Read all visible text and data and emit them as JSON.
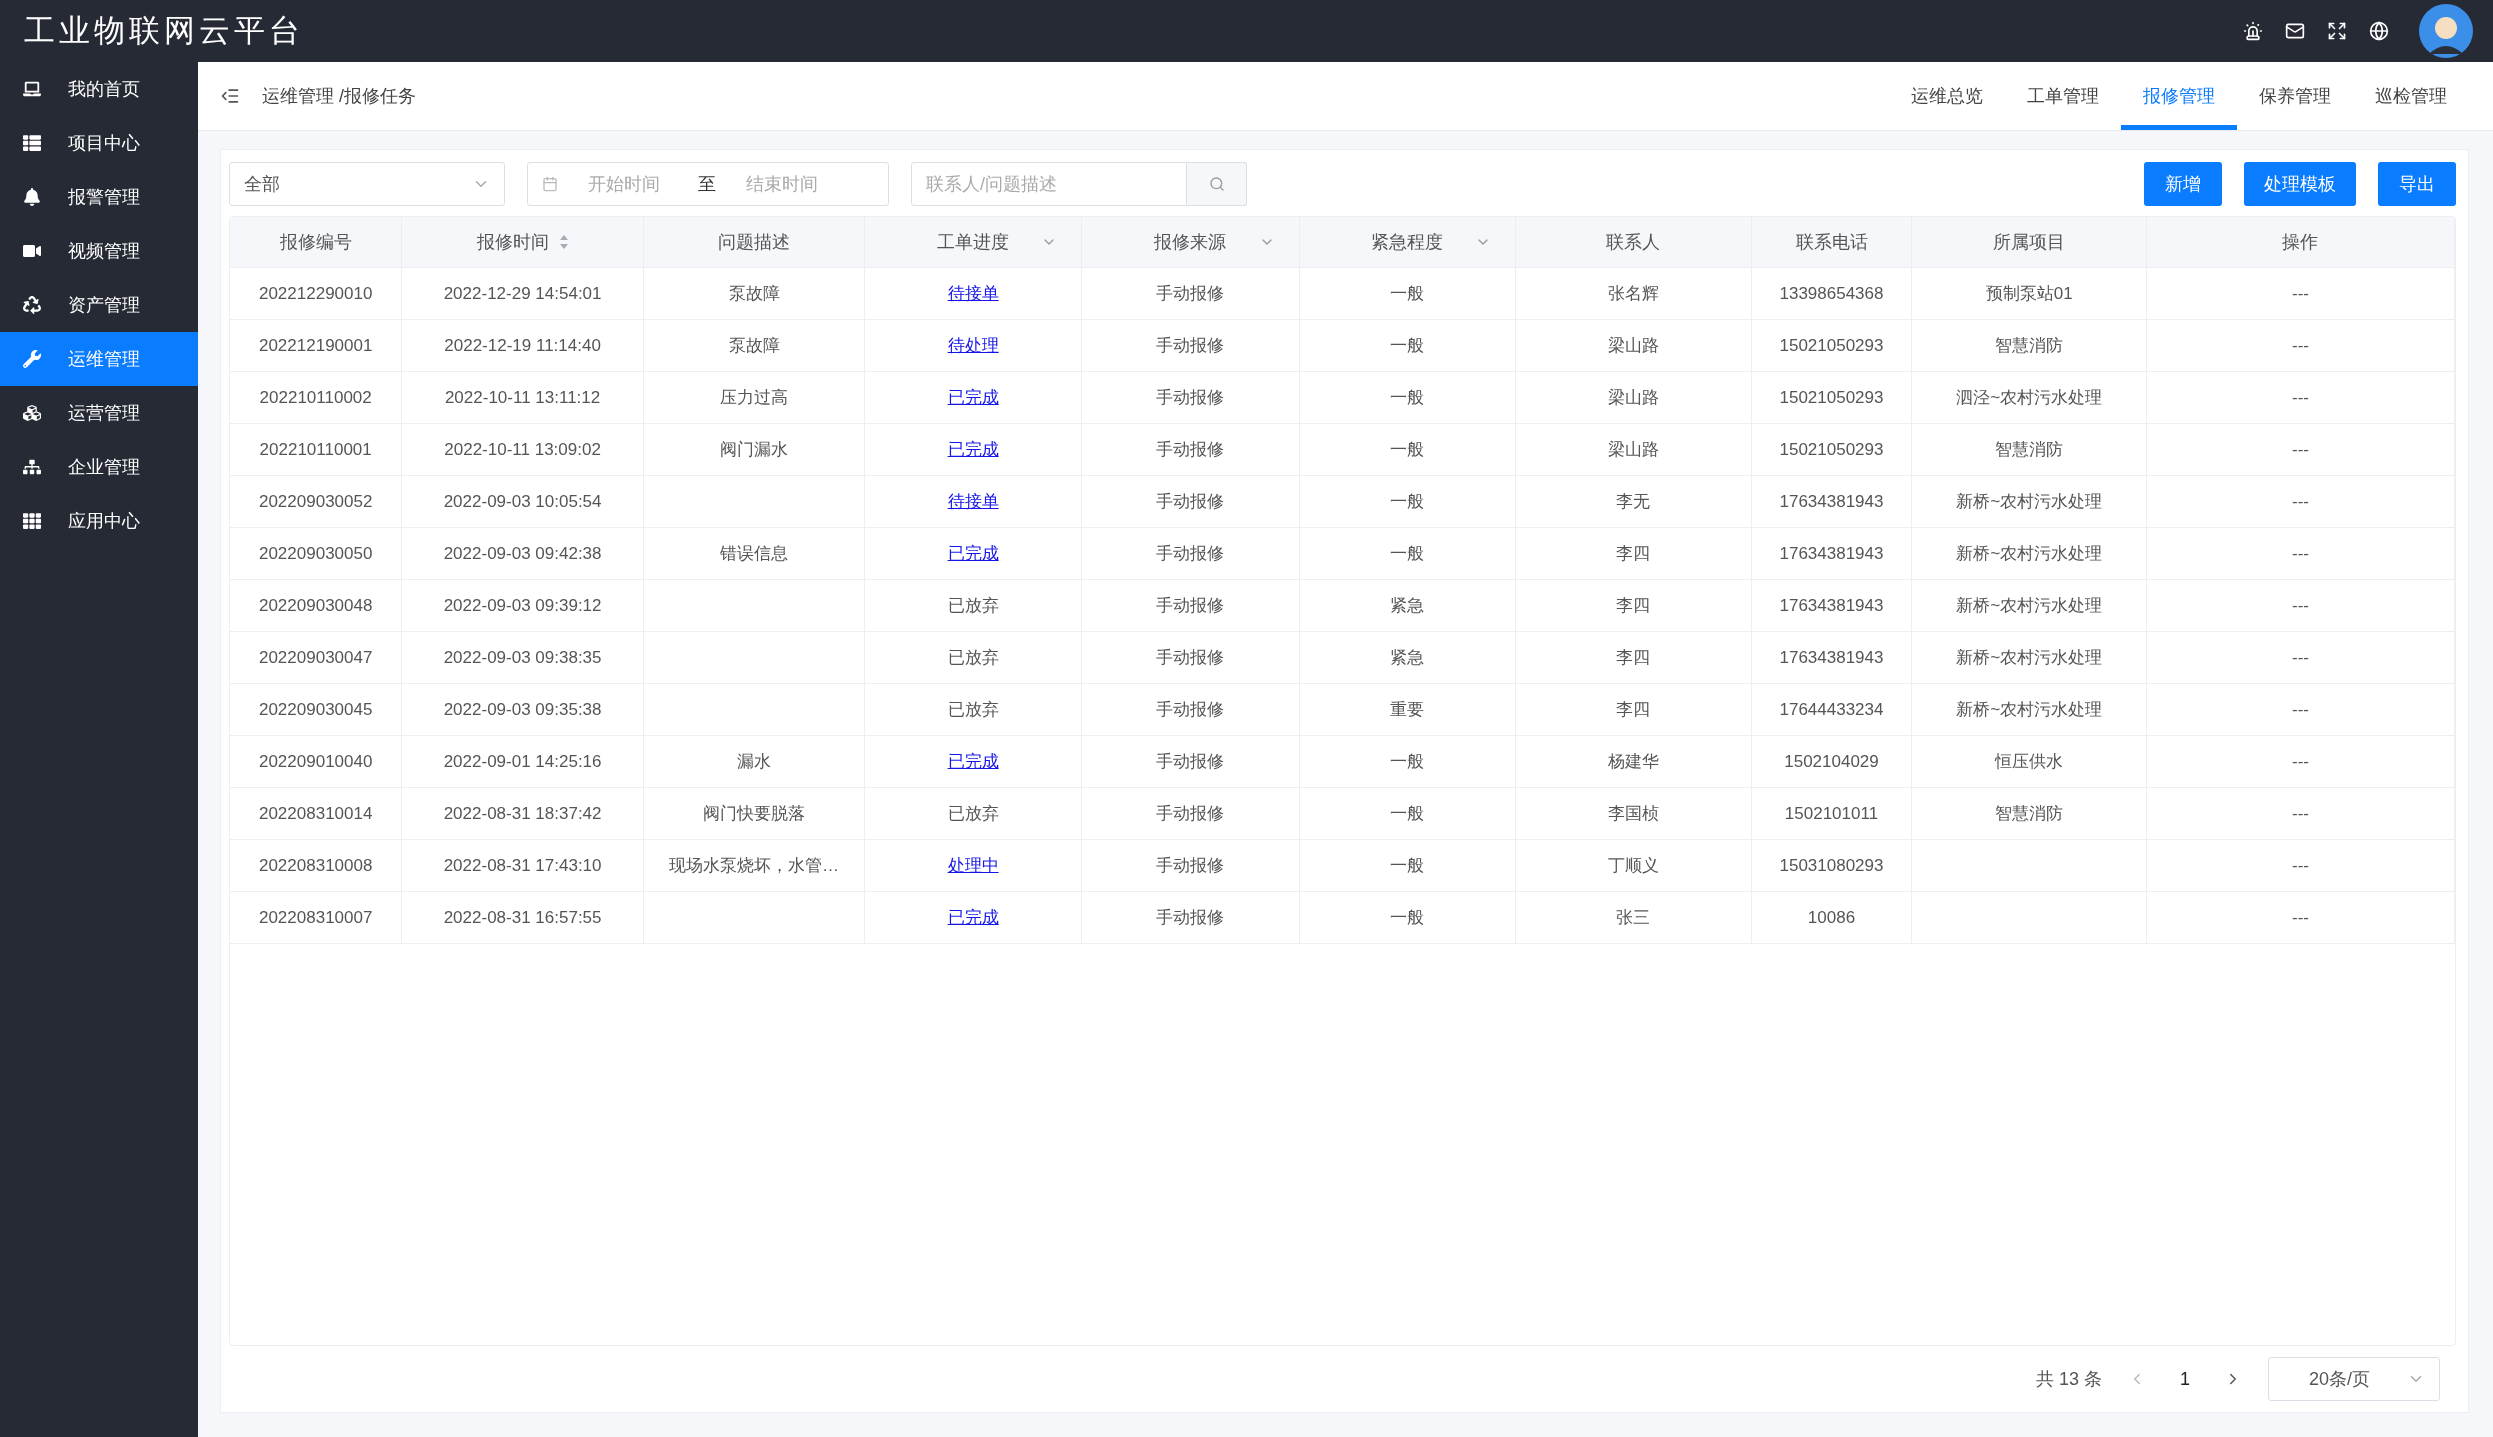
{
  "app_title": "工业物联网云平台",
  "sidebar": {
    "items": [
      {
        "label": "我的首页",
        "selected": false
      },
      {
        "label": "项目中心",
        "selected": false
      },
      {
        "label": "报警管理",
        "selected": false
      },
      {
        "label": "视频管理",
        "selected": false
      },
      {
        "label": "资产管理",
        "selected": false
      },
      {
        "label": "运维管理",
        "selected": true
      },
      {
        "label": "运营管理",
        "selected": false
      },
      {
        "label": "企业管理",
        "selected": false
      },
      {
        "label": "应用中心",
        "selected": false
      }
    ]
  },
  "breadcrumb": "运维管理 /报修任务",
  "tabs": [
    {
      "label": "运维总览",
      "selected": false
    },
    {
      "label": "工单管理",
      "selected": false
    },
    {
      "label": "报修管理",
      "selected": true
    },
    {
      "label": "保养管理",
      "selected": false
    },
    {
      "label": "巡检管理",
      "selected": false
    }
  ],
  "filters": {
    "status_select": "全部",
    "start_placeholder": "开始时间",
    "range_separator": "至",
    "end_placeholder": "结束时间",
    "search_placeholder": "联系人/问题描述"
  },
  "buttons": [
    "新增",
    "处理模板",
    "导出"
  ],
  "table": {
    "columns": [
      {
        "label": "报修编号",
        "kind": "plain"
      },
      {
        "label": "报修时间",
        "kind": "sort"
      },
      {
        "label": "问题描述",
        "kind": "plain"
      },
      {
        "label": "工单进度",
        "kind": "filter"
      },
      {
        "label": "报修来源",
        "kind": "filter"
      },
      {
        "label": "紧急程度",
        "kind": "filter"
      },
      {
        "label": "联系人",
        "kind": "plain"
      },
      {
        "label": "联系电话",
        "kind": "plain"
      },
      {
        "label": "所属项目",
        "kind": "plain"
      },
      {
        "label": "操作",
        "kind": "plain"
      }
    ],
    "rows": [
      {
        "id": "202212290010",
        "time": "2022-12-29 14:54:01",
        "description": "泵故障",
        "progress": "待接单",
        "progress_link": true,
        "source": "手动报修",
        "urgency": "一般",
        "contact": "张名辉",
        "phone": "13398654368",
        "project": "预制泵站01",
        "action": "---"
      },
      {
        "id": "202212190001",
        "time": "2022-12-19 11:14:40",
        "description": "泵故障",
        "progress": "待处理",
        "progress_link": true,
        "source": "手动报修",
        "urgency": "一般",
        "contact": "梁山路",
        "phone": "15021050293",
        "project": "智慧消防",
        "action": "---"
      },
      {
        "id": "202210110002",
        "time": "2022-10-11 13:11:12",
        "description": "压力过高",
        "progress": "已完成",
        "progress_link": true,
        "source": "手动报修",
        "urgency": "一般",
        "contact": "梁山路",
        "phone": "15021050293",
        "project": "泗泾~农村污水处理",
        "action": "---"
      },
      {
        "id": "202210110001",
        "time": "2022-10-11 13:09:02",
        "description": "阀门漏水",
        "progress": "已完成",
        "progress_link": true,
        "source": "手动报修",
        "urgency": "一般",
        "contact": "梁山路",
        "phone": "15021050293",
        "project": "智慧消防",
        "action": "---"
      },
      {
        "id": "202209030052",
        "time": "2022-09-03 10:05:54",
        "description": "",
        "progress": "待接单",
        "progress_link": true,
        "source": "手动报修",
        "urgency": "一般",
        "contact": "李无",
        "phone": "17634381943",
        "project": "新桥~农村污水处理",
        "action": "---"
      },
      {
        "id": "202209030050",
        "time": "2022-09-03 09:42:38",
        "description": "错误信息",
        "progress": "已完成",
        "progress_link": true,
        "source": "手动报修",
        "urgency": "一般",
        "contact": "李四",
        "phone": "17634381943",
        "project": "新桥~农村污水处理",
        "action": "---"
      },
      {
        "id": "202209030048",
        "time": "2022-09-03 09:39:12",
        "description": "",
        "progress": "已放弃",
        "progress_link": false,
        "source": "手动报修",
        "urgency": "紧急",
        "contact": "李四",
        "phone": "17634381943",
        "project": "新桥~农村污水处理",
        "action": "---"
      },
      {
        "id": "202209030047",
        "time": "2022-09-03 09:38:35",
        "description": "",
        "progress": "已放弃",
        "progress_link": false,
        "source": "手动报修",
        "urgency": "紧急",
        "contact": "李四",
        "phone": "17634381943",
        "project": "新桥~农村污水处理",
        "action": "---"
      },
      {
        "id": "202209030045",
        "time": "2022-09-03 09:35:38",
        "description": "",
        "progress": "已放弃",
        "progress_link": false,
        "source": "手动报修",
        "urgency": "重要",
        "contact": "李四",
        "phone": "17644433234",
        "project": "新桥~农村污水处理",
        "action": "---"
      },
      {
        "id": "202209010040",
        "time": "2022-09-01 14:25:16",
        "description": "漏水",
        "progress": "已完成",
        "progress_link": true,
        "source": "手动报修",
        "urgency": "一般",
        "contact": "杨建华",
        "phone": "1502104029",
        "project": "恒压供水",
        "action": "---"
      },
      {
        "id": "202208310014",
        "time": "2022-08-31 18:37:42",
        "description": "阀门快要脱落",
        "progress": "已放弃",
        "progress_link": false,
        "source": "手动报修",
        "urgency": "一般",
        "contact": "李国桢",
        "phone": "1502101011",
        "project": "智慧消防",
        "action": "---"
      },
      {
        "id": "202208310008",
        "time": "2022-08-31 17:43:10",
        "description": "现场水泵烧坏，水管…",
        "progress": "处理中",
        "progress_link": true,
        "source": "手动报修",
        "urgency": "一般",
        "contact": "丁顺义",
        "phone": "15031080293",
        "project": "",
        "action": "---"
      },
      {
        "id": "202208310007",
        "time": "2022-08-31 16:57:55",
        "description": "",
        "progress": "已完成",
        "progress_link": true,
        "source": "手动报修",
        "urgency": "一般",
        "contact": "张三",
        "phone": "10086",
        "project": "",
        "action": "---"
      }
    ]
  },
  "pagination": {
    "total": "共 13 条",
    "page": "1",
    "page_size": "20条/页"
  }
}
